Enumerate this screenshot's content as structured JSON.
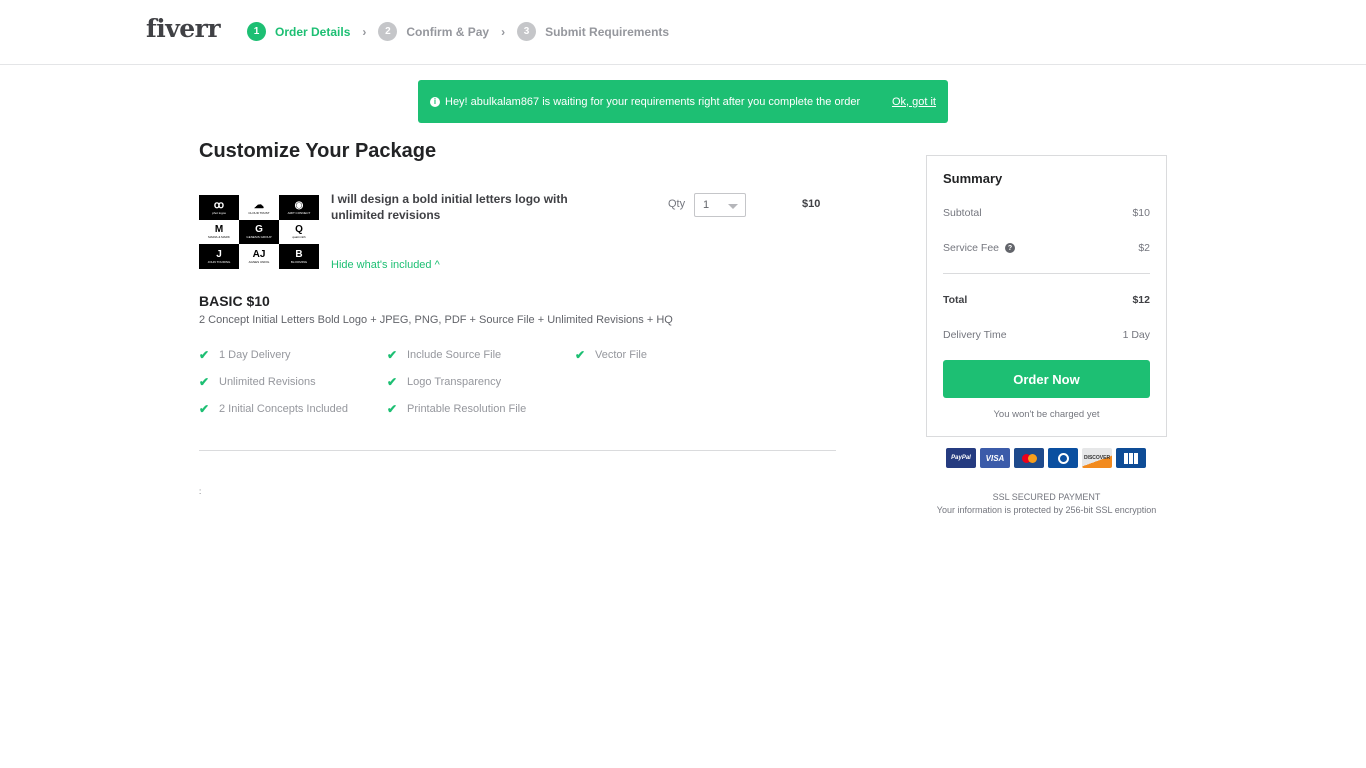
{
  "header": {
    "logo": "fiverr",
    "steps": [
      {
        "number": "1",
        "label": "Order Details",
        "active": true
      },
      {
        "number": "2",
        "label": "Confirm & Pay",
        "active": false
      },
      {
        "number": "3",
        "label": "Submit Requirements",
        "active": false
      }
    ],
    "chevron": "›"
  },
  "notice": {
    "icon": "info-icon",
    "message": "Hey! abulkalam867 is waiting for your requirements right after you complete the order",
    "dismiss_label": "Ok, got it"
  },
  "main": {
    "title": "Customize Your Package",
    "gig": {
      "title": "I will design a bold initial letters logo with unlimited revisions",
      "toggle_label": "Hide what's included ^",
      "thumbnail_tiles": [
        {
          "mark": "ꝏ",
          "caption": "phot logos",
          "dark": true
        },
        {
          "mark": "☁",
          "caption": "CLOUD TRUST",
          "dark": false
        },
        {
          "mark": "◉",
          "caption": "AMIT CONNECT",
          "dark": true
        },
        {
          "mark": "M",
          "caption": "MARIA & MARK",
          "dark": false
        },
        {
          "mark": "G",
          "caption": "GENESIS GROUP",
          "dark": true
        },
        {
          "mark": "Q",
          "caption": "quatrnnith",
          "dark": false
        },
        {
          "mark": "J",
          "caption": "JOHN TOURING",
          "dark": true
        },
        {
          "mark": "AJ",
          "caption": "AGNES UNFIG",
          "dark": false
        },
        {
          "mark": "B",
          "caption": "BLOOMING",
          "dark": true
        }
      ]
    },
    "qty": {
      "label": "Qty",
      "value": "1"
    },
    "line_price": "$10",
    "package": {
      "name": "BASIC $10",
      "description": "2 Concept Initial Letters Bold Logo + JPEG, PNG, PDF + Source File + Unlimited Revisions + HQ",
      "features": [
        "1 Day Delivery",
        "Unlimited Revisions",
        "2 Initial Concepts Included",
        "Include Source File",
        "Logo Transparency",
        "Printable Resolution File",
        "Vector File"
      ]
    },
    "stray_text": ":"
  },
  "summary": {
    "title": "Summary",
    "subtotal_label": "Subtotal",
    "subtotal_value": "$10",
    "service_fee_label": "Service Fee",
    "service_fee_value": "$2",
    "total_label": "Total",
    "total_value": "$12",
    "delivery_label": "Delivery Time",
    "delivery_value": "1 Day",
    "order_button": "Order Now",
    "no_charge_note": "You won't be charged yet"
  },
  "payment": {
    "cards": [
      "PayPal",
      "VISA",
      "MasterCard",
      "Diners Club",
      "DISCOVER",
      "JCB"
    ],
    "ssl_title": "SSL SECURED PAYMENT",
    "ssl_note": "Your information is protected by 256-bit SSL encryption"
  },
  "colors": {
    "brand_green": "#1dbf73",
    "text_dark": "#222325",
    "text_muted": "#74767e"
  }
}
